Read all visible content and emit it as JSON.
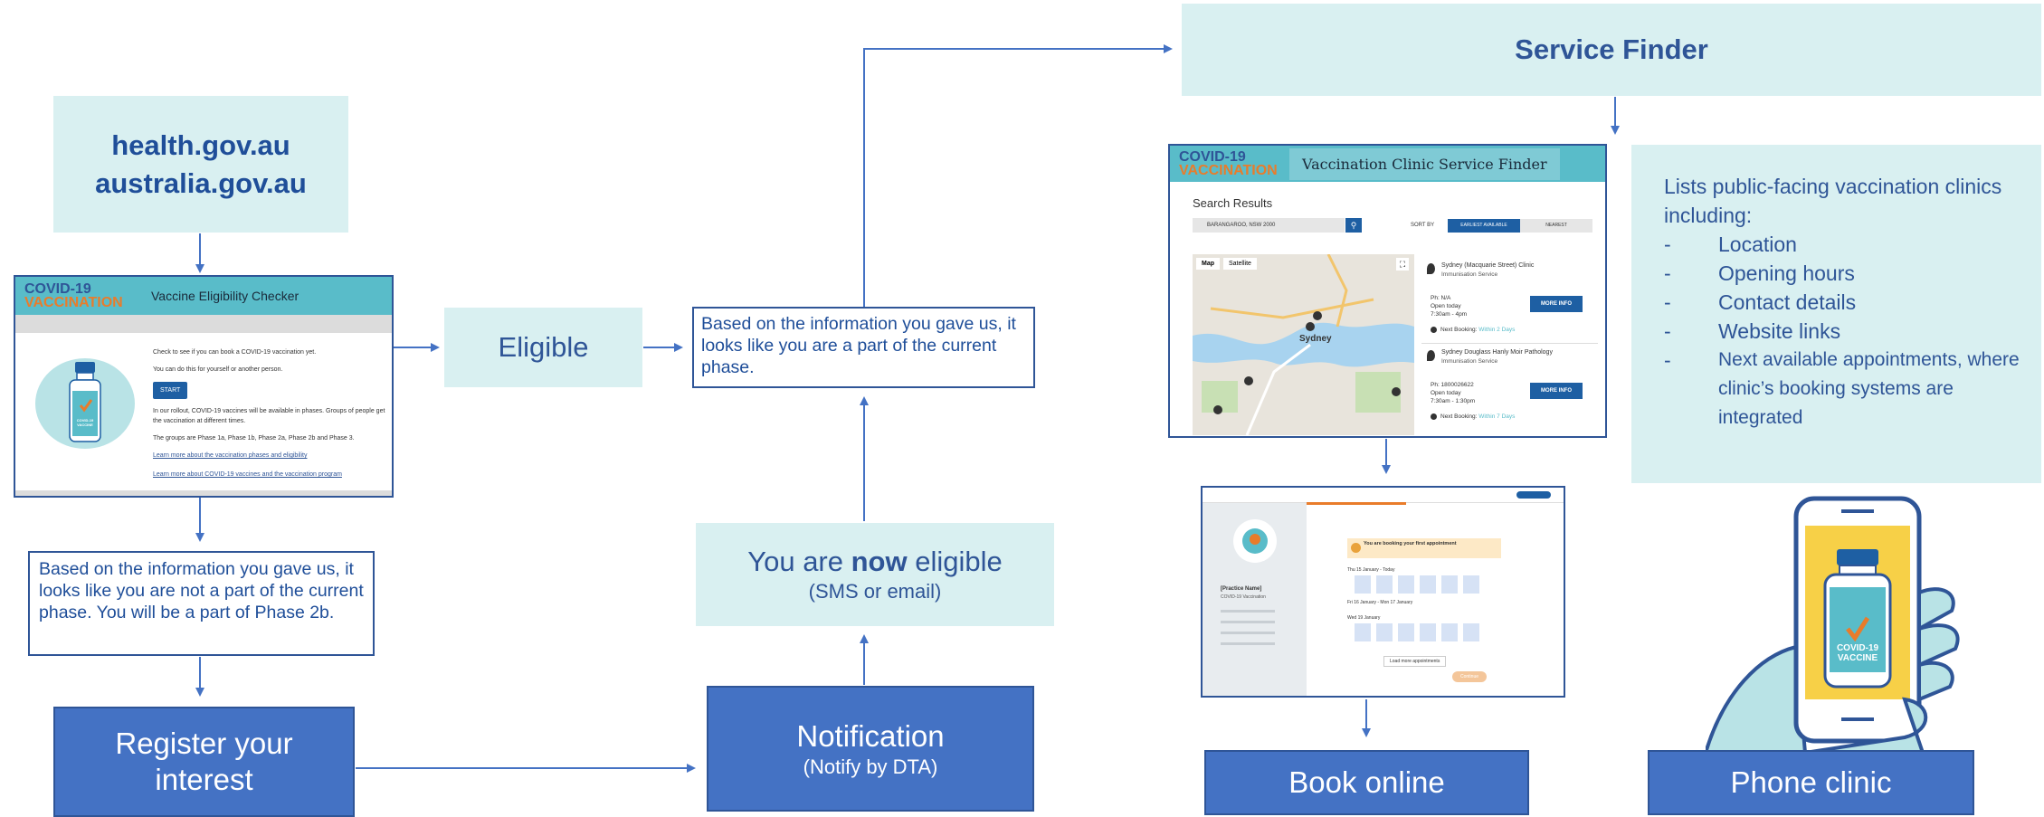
{
  "sites": {
    "line1": "health.gov.au",
    "line2": "australia.gov.au"
  },
  "eligibility_checker": {
    "logo_line1": "COVID-19",
    "logo_line2": "VACCINATION",
    "title": "Vaccine Eligibility Checker",
    "para1": "Check to see if you can book a COVID-19 vaccination yet.",
    "para2": "You can do this for yourself or another person.",
    "start_button": "START",
    "para3": "In our rollout, COVID-19 vaccines will be available in phases. Groups of people get the vaccination at different times.",
    "para4": "The groups are Phase 1a, Phase 1b, Phase 2a, Phase 2b and Phase 3.",
    "link1": "Learn more about the vaccination phases and eligibility",
    "link2": "Learn more about COVID-19 vaccines and the vaccination program",
    "vial_label": "COVID-19 VACCINE"
  },
  "eligible_box": {
    "label": "Eligible"
  },
  "not_eligible_box": {
    "text": "Based on the information you gave us, it looks like you are not a part of the current phase. You will be a part of Phase 2b."
  },
  "current_phase_box": {
    "text": "Based on the information you gave us, it looks like you are a part of the current phase."
  },
  "register_box": {
    "line1": "Register your",
    "line2": "interest"
  },
  "notification_box": {
    "title": "Notification",
    "subtitle": "(Notify by DTA)"
  },
  "now_eligible_box": {
    "prefix": "You are ",
    "emphasis": "now",
    "suffix": " eligible",
    "subtitle": "(SMS or email)"
  },
  "service_finder": {
    "title": "Service Finder"
  },
  "clinic_finder": {
    "logo_line1": "COVID-19",
    "logo_line2": "VACCINATION",
    "title": "Vaccination Clinic Service Finder",
    "search_results": "Search Results",
    "search_value": "BARANGAROO, NSW 2000",
    "sort_by": "SORT BY",
    "sort_options": [
      "EARLIEST AVAILABLE",
      "NEAREST"
    ],
    "map_tabs": [
      "Map",
      "Satellite"
    ],
    "map_city_label": "Sydney",
    "clinics": [
      {
        "name": "Sydney (Macquarie Street) Clinic",
        "type": "Immunisation Service",
        "phone": "Ph: N/A",
        "status": "Open today",
        "hours": "7:30am - 4pm",
        "next_label": "Next Booking:",
        "next_value": "Within 2 Days",
        "button": "MORE INFO"
      },
      {
        "name": "Sydney Douglass Hanly Moir Pathology",
        "type": "Immunisation Service",
        "phone": "Ph: 1800026622",
        "status": "Open today",
        "hours": "7:30am - 1:30pm",
        "next_label": "Next Booking:",
        "next_value": "Within 7 Days",
        "button": "MORE INFO"
      }
    ]
  },
  "booking_screen": {
    "practice_name": "[Practice Name]",
    "practice_sub": "COVID-19 Vaccination",
    "notice": "You are booking your first appointment",
    "day_labels": [
      "Thu 15 January - Today",
      "Fri 16 January - Mon 17 January",
      "Wed 19 January"
    ],
    "load_more": "Load more appointments",
    "continue": "Continue"
  },
  "info_list": {
    "heading": "Lists public-facing vaccination clinics including:",
    "items": [
      "Location",
      "Opening hours",
      "Contact details",
      "Website links",
      "Next available appointments, where clinic’s booking systems are integrated"
    ]
  },
  "phone_vial_label": "COVID-19 VACCINE",
  "book_online": {
    "label": "Book online"
  },
  "phone_clinic": {
    "label": "Phone clinic"
  },
  "colors": {
    "light_box": "#d9f0f1",
    "dark_box": "#4472c4",
    "text_blue": "#1f4e99",
    "arrow": "#4472c4",
    "header_teal": "#59bcc9",
    "accent_orange": "#e97c2b"
  }
}
